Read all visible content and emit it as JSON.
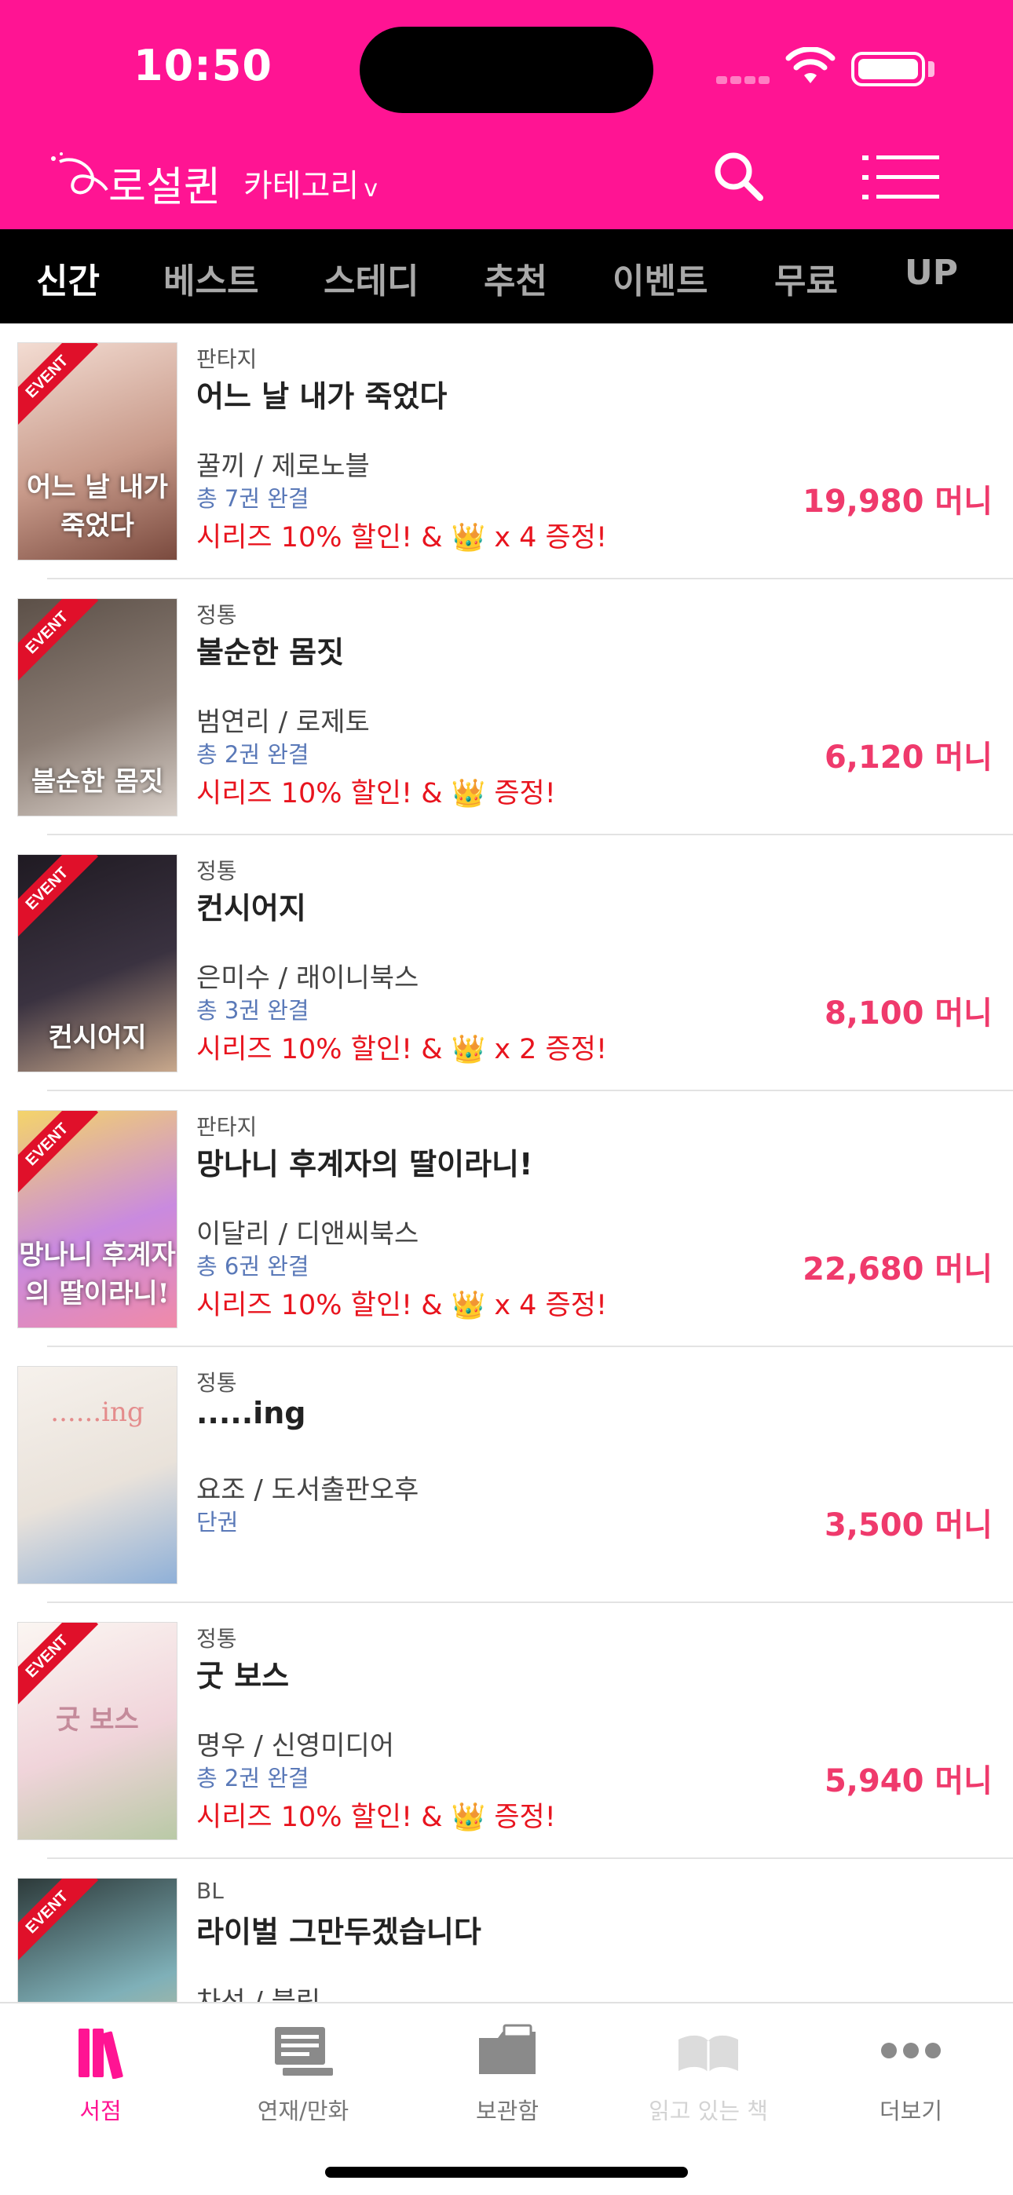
{
  "status": {
    "time": "10:50"
  },
  "header": {
    "logo_text": "로설퀸",
    "category_label": "카테고리",
    "category_chevron": "v",
    "search_icon": "search-icon",
    "menu_icon": "menu-icon",
    "bg_color": "#ff1493"
  },
  "tabs": [
    {
      "label": "신간",
      "active": true
    },
    {
      "label": "베스트"
    },
    {
      "label": "스테디"
    },
    {
      "label": "추천"
    },
    {
      "label": "이벤트"
    },
    {
      "label": "무료"
    },
    {
      "label": "UP"
    }
  ],
  "books": [
    {
      "event": "EVENT",
      "genre": "판타지",
      "title": "어느 날 내가 죽었다",
      "cover_text": "어느 날 내가 죽었다",
      "author": "꿀끼 / 제로노블",
      "volumes": "총 7권 완결",
      "promo": "시리즈 10% 할인! & 👑 x 4 증정!",
      "price": "19,980 머니",
      "cover_colors": [
        "#f3dcd2",
        "#c89a8a",
        "#7a4a3e"
      ]
    },
    {
      "event": "EVENT",
      "genre": "정통",
      "title": "불순한 몸짓",
      "cover_text": "불순한 몸짓",
      "author": "범연리 / 로제토",
      "volumes": "총 2권 완결",
      "promo": "시리즈 10% 할인! & 👑 증정!",
      "price": "6,120 머니",
      "cover_colors": [
        "#5c5048",
        "#8b7d74",
        "#d8cfc8"
      ]
    },
    {
      "event": "EVENT",
      "genre": "정통",
      "title": "컨시어지",
      "cover_text": "컨시어지",
      "author": "은미수 / 래이니북스",
      "volumes": "총 3권 완결",
      "promo": "시리즈 10% 할인! & 👑 x 2 증정!",
      "price": "8,100 머니",
      "cover_colors": [
        "#1f1a22",
        "#3a3240",
        "#c8a88c"
      ]
    },
    {
      "event": "EVENT",
      "genre": "판타지",
      "title": "망나니 후계자의 딸이라니!",
      "cover_text": "망나니 후계자의 딸이라니!",
      "author": "이달리 / 디앤씨북스",
      "volumes": "총 6권 완결",
      "promo": "시리즈 10% 할인! & 👑 x 4 증정!",
      "price": "22,680 머니",
      "cover_colors": [
        "#f4d46a",
        "#c98adf",
        "#f08aa8"
      ]
    },
    {
      "event": "",
      "genre": "정통",
      "title": ".....ing",
      "cover_text": "......ing",
      "author": "요조 / 도서출판오후",
      "volumes": "단권",
      "promo": "",
      "price": "3,500 머니",
      "cover_colors": [
        "#f6f1ec",
        "#e9e2da",
        "#8fb0d8"
      ]
    },
    {
      "event": "EVENT",
      "genre": "정통",
      "title": "굿 보스",
      "cover_text": "굿 보스",
      "author": "명우 / 신영미디어",
      "volumes": "총 2권 완결",
      "promo": "시리즈 10% 할인! & 👑 증정!",
      "price": "5,940 머니",
      "cover_colors": [
        "#fbf6f2",
        "#f0d4da",
        "#b9c9a6"
      ]
    },
    {
      "event": "EVENT",
      "genre": "BL",
      "title": "라이벌 그만두겠습니다",
      "cover_text": "",
      "author": "차선 / 블릿",
      "volumes": "",
      "promo": "",
      "price": "",
      "cover_colors": [
        "#2d3a3a",
        "#7fb0b8",
        "#e0c48a"
      ]
    }
  ],
  "tabbar": [
    {
      "label": "서점",
      "icon": "bookstore-icon",
      "state": "active"
    },
    {
      "label": "연재/만화",
      "icon": "serial-icon",
      "state": "normal"
    },
    {
      "label": "보관함",
      "icon": "folder-icon",
      "state": "normal"
    },
    {
      "label": "읽고 있는 책",
      "icon": "open-book-icon",
      "state": "dim"
    },
    {
      "label": "더보기",
      "icon": "more-icon",
      "state": "normal"
    }
  ],
  "colors": {
    "accent": "#ff1493",
    "price": "#ef3a6c",
    "promo": "#e8141e",
    "volumes": "#5a79b8"
  }
}
